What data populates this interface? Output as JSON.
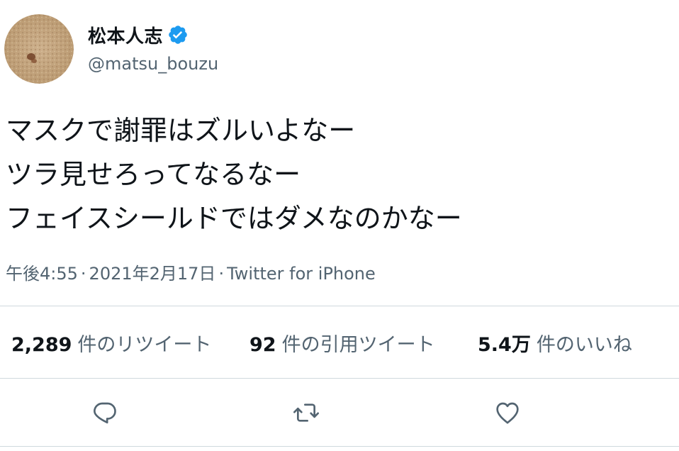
{
  "user": {
    "display_name": "松本人志",
    "handle": "@matsu_bouzu",
    "verified": true,
    "verified_color": "#1d9bf0"
  },
  "tweet": {
    "lines": [
      "マスクで謝罪はズルいよなー",
      "ツラ見せろってなるなー",
      "フェイスシールドではダメなのかなー"
    ]
  },
  "meta": {
    "time": "午後4:55",
    "date": "2021年2月17日",
    "separator": "·",
    "source": "Twitter for iPhone"
  },
  "stats": {
    "retweets": {
      "count": "2,289",
      "label": "件のリツイート"
    },
    "quotes": {
      "count": "92",
      "label": "件の引用ツイート"
    },
    "likes": {
      "count": "5.4万",
      "label": "件のいいね"
    }
  },
  "actions": {
    "reply_icon": "reply-icon",
    "retweet_icon": "retweet-icon",
    "like_icon": "heart-icon"
  },
  "colors": {
    "text": "#0f1419",
    "secondary": "#536471",
    "divider": "#cfd9de",
    "icon": "#536471"
  }
}
